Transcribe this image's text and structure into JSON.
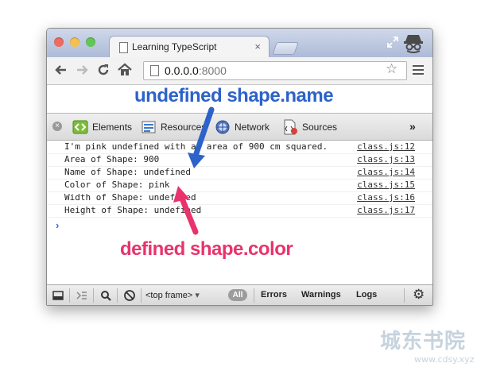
{
  "browser": {
    "tab_title": "Learning TypeScript",
    "tab_close": "×",
    "url_host": "0.0.0.0",
    "url_port": ":8000",
    "star": "☆"
  },
  "devtools": {
    "close": "×",
    "tabs": [
      {
        "label": "Elements",
        "icon": "elements-icon"
      },
      {
        "label": "Resources",
        "icon": "resources-icon"
      },
      {
        "label": "Network",
        "icon": "network-icon"
      },
      {
        "label": "Sources",
        "icon": "sources-icon"
      }
    ],
    "more": "»"
  },
  "console": {
    "rows": [
      {
        "message": "I'm pink undefined with an area of 900 cm squared.",
        "source": "class.js:12"
      },
      {
        "message": "Area of Shape: 900",
        "source": "class.js:13"
      },
      {
        "message": "Name of Shape: undefined",
        "source": "class.js:14"
      },
      {
        "message": "Color of Shape: pink",
        "source": "class.js:15"
      },
      {
        "message": "Width of Shape: undefined",
        "source": "class.js:16"
      },
      {
        "message": "Height of Shape: undefined",
        "source": "class.js:17"
      }
    ],
    "prompt": "›"
  },
  "bottombar": {
    "frame": "<top frame>",
    "frame_arrow": "▾",
    "all": "All",
    "errors": "Errors",
    "warnings": "Warnings",
    "logs": "Logs",
    "gear": "⚙"
  },
  "annotations": {
    "top": "undefined shape.name",
    "bottom": "defined shape.color",
    "top_color": "#2c62c9",
    "bottom_color": "#e8336c"
  },
  "watermark": {
    "text": "城东书院",
    "url": "www.cdsy.xyz"
  }
}
